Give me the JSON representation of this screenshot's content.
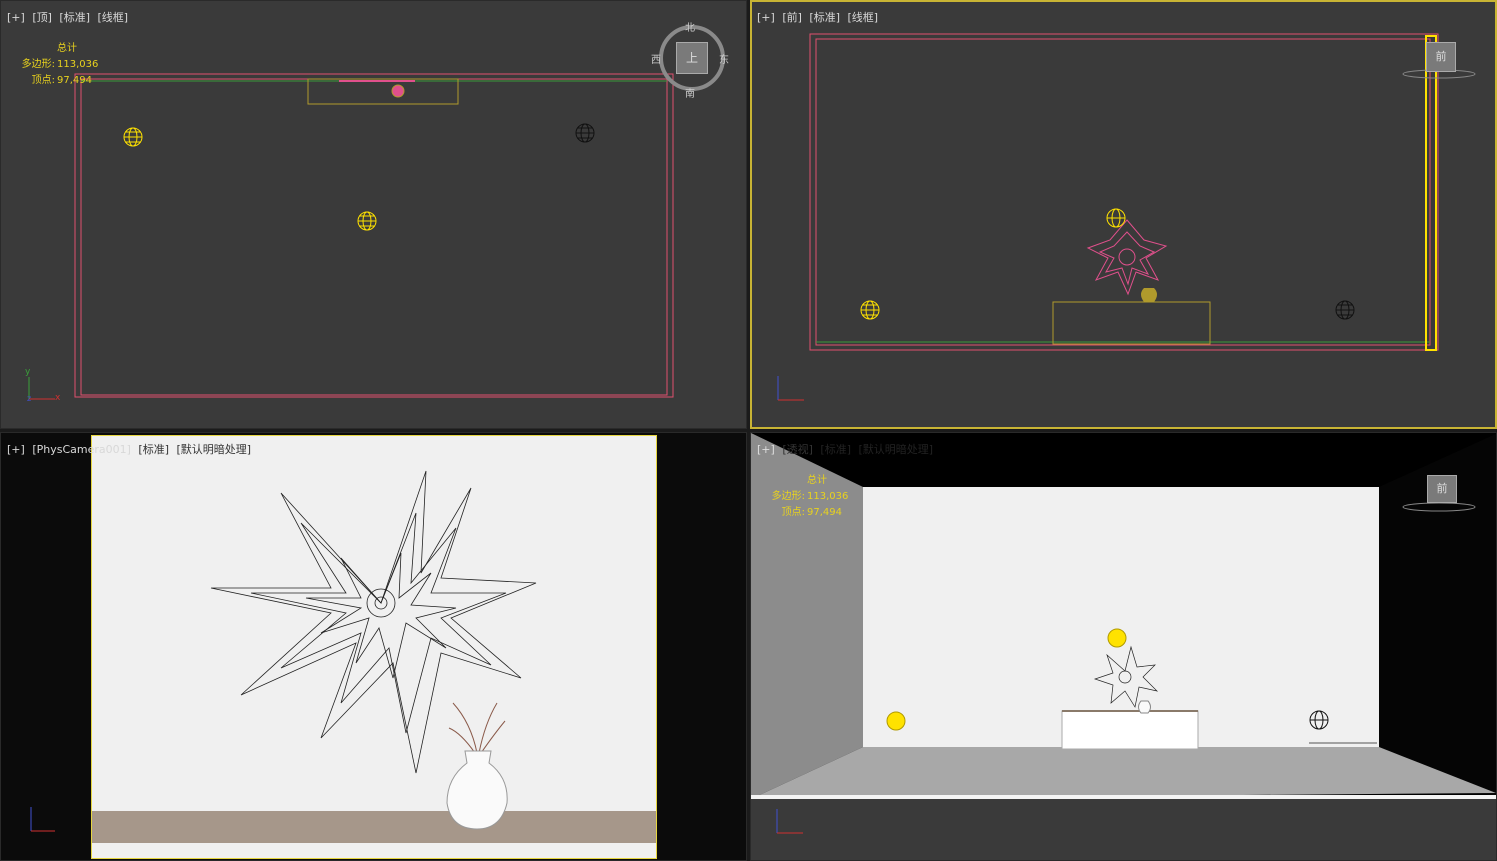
{
  "stats": {
    "title": "总计",
    "poly_label": "多边形:",
    "poly_value": "113,036",
    "vert_label": "顶点:",
    "vert_value": "97,494"
  },
  "viewports": {
    "top": {
      "plus": "[+]",
      "view": "[顶]",
      "shading": "[标准]",
      "mode": "[线框]"
    },
    "front": {
      "plus": "[+]",
      "view": "[前]",
      "shading": "[标准]",
      "mode": "[线框]"
    },
    "camera": {
      "plus": "[+]",
      "view": "[PhysCamera001]",
      "shading": "[标准]",
      "mode": "[默认明暗处理]"
    },
    "persp": {
      "plus": "[+]",
      "view": "[透视]",
      "shading": "[标准]",
      "mode": "[默认明暗处理]"
    }
  },
  "viewcube": {
    "north": "北",
    "south": "南",
    "east": "东",
    "west": "西",
    "top_face": "上",
    "front_face": "前"
  },
  "axes": {
    "x": "x",
    "y": "y",
    "z": "z"
  },
  "colors": {
    "viewport_bg": "#3a3a3a",
    "active_border": "#c8b434",
    "wire_room": "#e0506e",
    "wire_table": "#b09a2c",
    "light_yellow": "#ffe200",
    "flower_pink": "#e0508c"
  }
}
